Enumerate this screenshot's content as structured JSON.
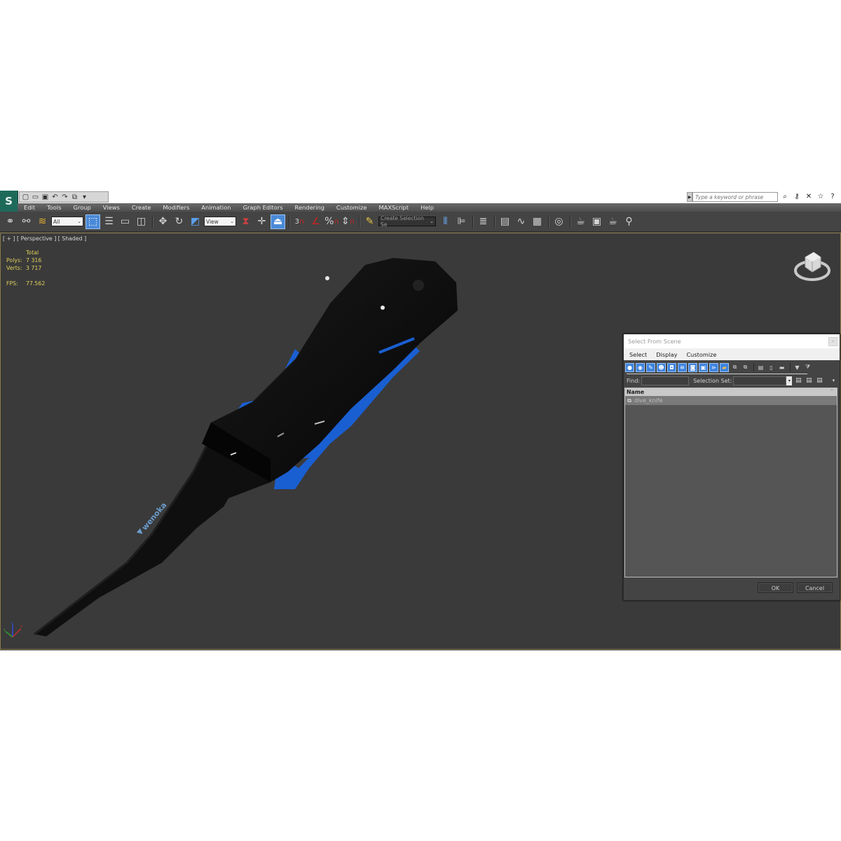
{
  "app": {
    "logo_glyph": "S",
    "quick_access": [
      "new-icon",
      "open-icon",
      "save-icon",
      "undo-icon",
      "redo-icon",
      "project-icon",
      "dropdown-icon"
    ],
    "search": {
      "placeholder": "Type a keyword or phrase"
    },
    "help_icons": [
      "binoculars-icon",
      "key-icon",
      "satellite-icon",
      "star-icon",
      "help-icon"
    ]
  },
  "menubar": {
    "items": [
      "Edit",
      "Tools",
      "Group",
      "Views",
      "Create",
      "Modifiers",
      "Animation",
      "Graph Editors",
      "Rendering",
      "Customize",
      "MAXScript",
      "Help"
    ]
  },
  "toolbar": {
    "selection_filter": "All",
    "reference_coord": "View",
    "named_selection": "Create Selection Se",
    "snap_label": "3"
  },
  "viewport": {
    "label": "[ + ] [ Perspective ] [ Shaded ]",
    "stats": {
      "header": "Total",
      "polys_label": "Polys:",
      "polys_value": "7 316",
      "verts_label": "Verts:",
      "verts_value": "3 717",
      "fps_label": "FPS:",
      "fps_value": "77.562"
    },
    "brand_text": "wenoka",
    "colors": {
      "background": "#3a3a3a",
      "knife_body": "#0e0e0e",
      "accent_blue": "#1a5fd1",
      "stat_text": "#e0d05a"
    }
  },
  "dialog": {
    "title": "Select From Scene",
    "menu": [
      "Select",
      "Display",
      "Customize"
    ],
    "find_label": "Find:",
    "find_value": "",
    "selection_set_label": "Selection Set:",
    "selection_set_value": "",
    "list_header": "Name",
    "rows": [
      {
        "name": "dive_knife"
      }
    ],
    "ok_label": "OK",
    "cancel_label": "Cancel"
  }
}
